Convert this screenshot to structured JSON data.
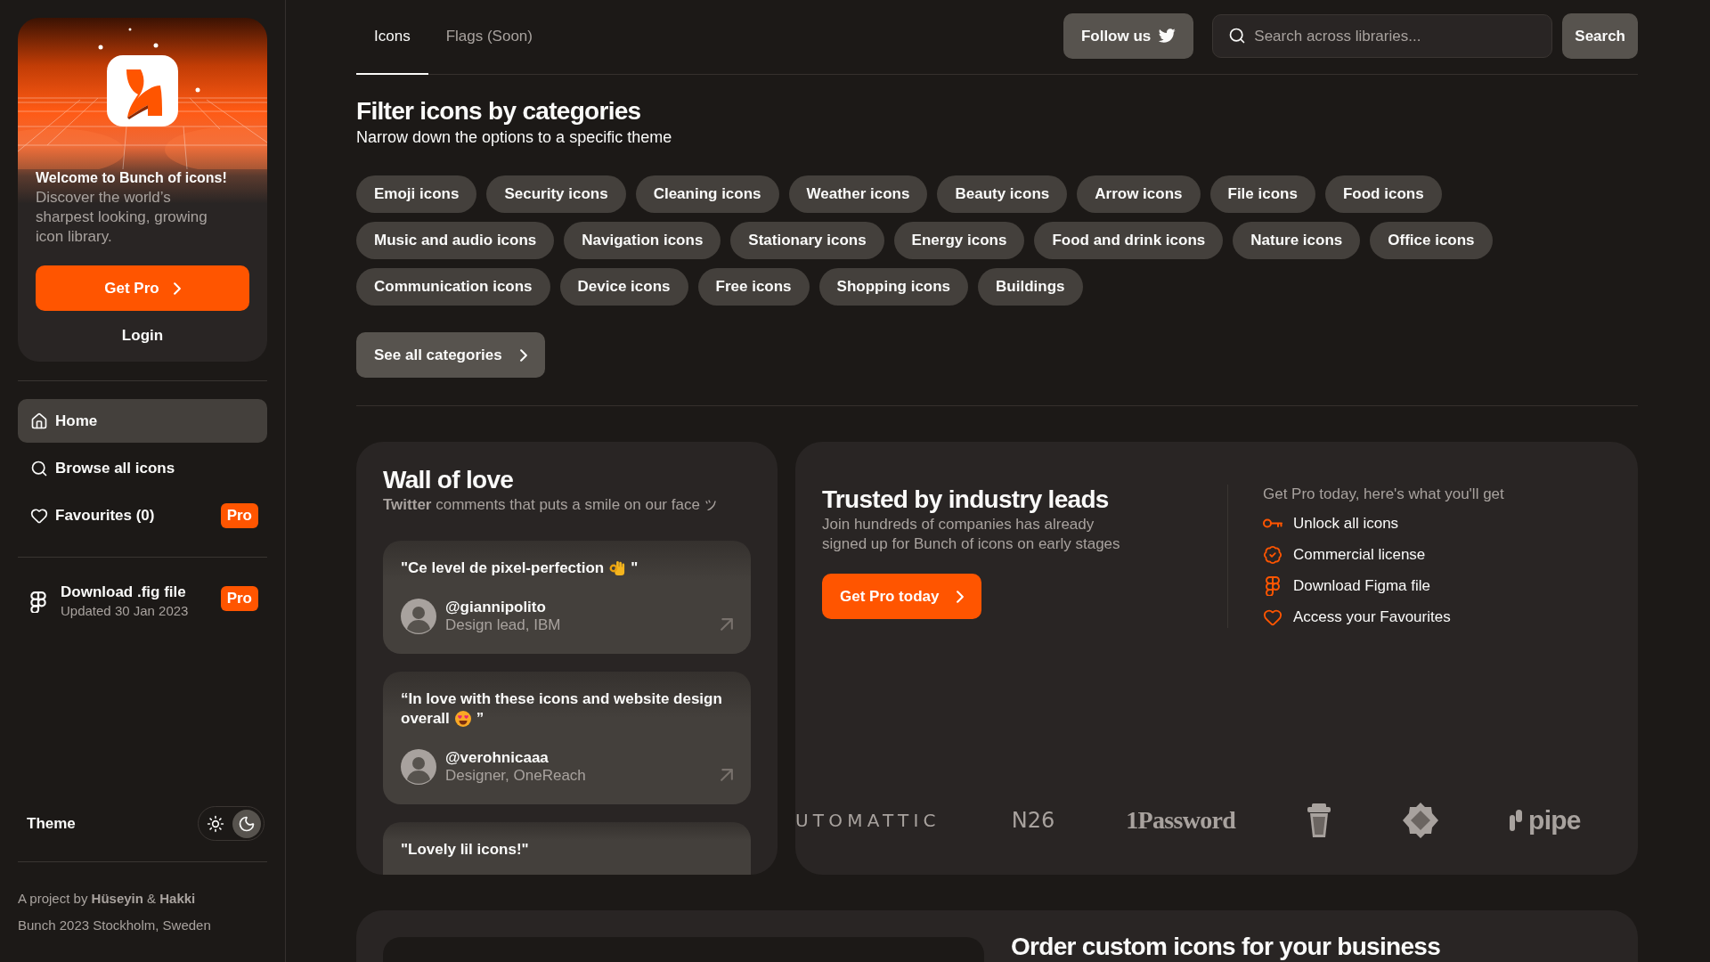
{
  "sidebar": {
    "welcome": {
      "title": "Welcome to Bunch of icons!",
      "text": "Discover the world’s sharpest looking, growing icon library.",
      "button": "Get Pro",
      "link": "Login"
    },
    "nav": [
      {
        "kind": "home",
        "label": "Home",
        "selected": true
      },
      {
        "kind": "browse",
        "label": "Browse all icons",
        "selected": false
      },
      {
        "kind": "favourites",
        "label": "Favourites (0)",
        "selected": false,
        "badge": "Pro"
      }
    ],
    "download": {
      "title": "Download .fig file",
      "subtitle": "Updated 30 Jan 2023",
      "badge": "Pro"
    },
    "theme": {
      "label": "Theme",
      "options": [
        {
          "kind": "light",
          "selected": false
        },
        {
          "kind": "dark",
          "selected": true
        }
      ]
    },
    "footer": [
      "A project by **Hüseyin** & **Hakki**",
      "Bunch 2023 Stockholm, Sweden"
    ]
  },
  "tabs": [
    {
      "label": "Icons",
      "selected": true
    },
    {
      "label": "Flags (Soon)",
      "selected": false
    }
  ],
  "header": {
    "follow_button": "Follow us",
    "search": {
      "placeholder": "Search across libraries..."
    },
    "search_button": "Search"
  },
  "categories": {
    "title": "Filter icons by categories",
    "subtitle": "Narrow down the options to a specific theme",
    "chips": [
      "Emoji icons",
      "Security icons",
      "Cleaning icons",
      "Weather icons",
      "Beauty icons",
      "Arrow icons",
      "File icons",
      "Food icons",
      "Music and audio icons",
      "Navigation icons",
      "Stationary icons",
      "Energy icons",
      "Food and drink icons",
      "Nature icons",
      "Office icons",
      "Communication icons",
      "Device icons",
      "Free icons",
      "Shopping icons",
      "Buildings"
    ],
    "see_all": "See all categories"
  },
  "wall_of_love": {
    "title": "Wall of love",
    "subtitle": "**Twitter** comments that puts a smile on our face",
    "testimonials": [
      {
        "quote_lines": [
          [
            {
              "kind": "text",
              "text": "\"Ce level de pixel-perfection"
            },
            {
              "kind": "ok-hand"
            },
            {
              "kind": "text",
              "text": "\""
            }
          ]
        ],
        "handle": "@giannipolito",
        "role": "Design lead, IBM"
      },
      {
        "quote_lines": [
          [
            {
              "kind": "text",
              "text": "“In love with these icons and website design"
            }
          ],
          [
            {
              "kind": "text",
              "text": "overall"
            },
            {
              "kind": "heart-eyes"
            },
            {
              "kind": "text",
              "text": "”"
            }
          ]
        ],
        "handle": "@verohnicaaa",
        "role": "Designer, OneReach"
      },
      {
        "quote_lines": [
          [
            {
              "kind": "text",
              "text": "\"Lovely lil icons!\""
            }
          ]
        ]
      }
    ]
  },
  "trusted": {
    "title": "Trusted by industry leads",
    "text": "Join hundreds of companies has already signed up for Bunch of icons on early stages",
    "button": "Get Pro today",
    "perks_title": "Get Pro today, here's what you'll get",
    "perks": [
      {
        "kind": "key",
        "label": "Unlock all icons"
      },
      {
        "kind": "license",
        "label": "Commercial license"
      },
      {
        "kind": "figma",
        "label": "Download Figma file"
      },
      {
        "kind": "heart",
        "label": "Access your Favourites"
      }
    ],
    "logos": [
      {
        "kind": "spaced",
        "text": "UTOMATTIC"
      },
      {
        "kind": "plain",
        "text": "N26"
      },
      {
        "kind": "serif",
        "text": "1Password"
      },
      {
        "kind": "cup"
      },
      {
        "kind": "seal"
      },
      {
        "kind": "pipe",
        "text": "pipe"
      }
    ]
  },
  "order": {
    "title": "Order custom icons for your business"
  }
}
